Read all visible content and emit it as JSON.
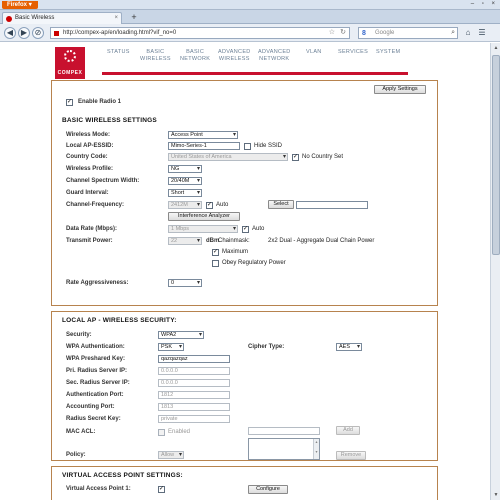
{
  "browser": {
    "app_button": "Firefox",
    "tab_title": "Basic Wireless",
    "url": "http://compex-ap/en/loading.html?vif_no=0",
    "search_placeholder": "Google",
    "window_controls": "– ▫ ×"
  },
  "icons": [
    "firefox-menu-icon",
    "favicon-icon",
    "back-icon",
    "forward-icon",
    "stop-icon",
    "home-icon",
    "star-icon",
    "reload-icon",
    "google-icon",
    "search-icon",
    "bookmarks-icon"
  ],
  "logo": {
    "text": "COMPEX",
    "color": "#c8102e"
  },
  "nav": [
    {
      "line1": "STATUS",
      "line2": ""
    },
    {
      "line1": "BASIC",
      "line2": "WIRELESS"
    },
    {
      "line1": "BASIC",
      "line2": "NETWORK"
    },
    {
      "line1": "ADVANCED",
      "line2": "WIRELESS"
    },
    {
      "line1": "ADVANCED",
      "line2": "NETWORK"
    },
    {
      "line1": "VLAN",
      "line2": ""
    },
    {
      "line1": "SERVICES",
      "line2": ""
    },
    {
      "line1": "SYSTEM",
      "line2": ""
    }
  ],
  "panel1": {
    "apply_button": "Apply Settings",
    "enable_radio": {
      "label": "Enable Radio 1",
      "checked": "✓"
    },
    "section_title": "BASIC WIRELESS SETTINGS",
    "labels": {
      "wireless_mode": "Wireless Mode:",
      "essid": "Local AP-ESSID:",
      "country": "Country Code:",
      "profile": "Wireless Profile:",
      "bandwidth": "Channel Spectrum Width:",
      "guard": "Guard Interval:",
      "frequency": "Channel-Frequency:",
      "data_rate": "Data Rate (Mbps):",
      "tx_power": "Transmit Power:",
      "aggressiveness": "Rate Aggressiveness:"
    },
    "values": {
      "wireless_mode": "Access Point",
      "essid": "Mimo-Series-1",
      "hide_ssid": "Hide SSID",
      "country": "United States of America",
      "no_country": "No Country Set",
      "profile": "NG",
      "bandwidth": "20/40M",
      "guard": "Short",
      "frequency": "2412M",
      "auto": "Auto",
      "select_button": "Select",
      "interference_button": "Interference Analyzer",
      "data_rate": "1 Mbps",
      "data_rate_auto": "Auto",
      "tx_power": "22",
      "dbm": "dBm",
      "chainmask_label": "Chainmask:",
      "chainmask_value": "2x2 Dual - Aggregate Dual Chain Power",
      "maximum": "Maximum",
      "obey": "Obey Regulatory Power",
      "aggressiveness": "0"
    }
  },
  "panel2": {
    "section_title": "LOCAL AP - WIRELESS SECURITY:",
    "labels": {
      "security": "Security:",
      "wpa_auth": "WPA Authentication:",
      "cipher": "Cipher Type:",
      "psk": "WPA Preshared Key:",
      "pri_radius": "Pri. Radius Server IP:",
      "sec_radius": "Sec. Radius Server IP:",
      "auth_port": "Authentication Port:",
      "acct_port": "Accounting Port:",
      "radius_key": "Radius Secret Key:",
      "mac_acl": "MAC ACL:",
      "policy": "Policy:"
    },
    "values": {
      "security": "WPA2",
      "wpa_auth": "PSK",
      "cipher": "AES",
      "psk": "qazqazqaz",
      "pri_radius": "0.0.0.0",
      "sec_radius": "0.0.0.0",
      "auth_port": "1812",
      "acct_port": "1813",
      "radius_key": "private",
      "mac_enabled": "Enabled",
      "add_button": "Add",
      "policy": "Allow",
      "remove_button": "Remove"
    }
  },
  "panel3": {
    "section_title": "VIRTUAL ACCESS POINT SETTINGS:",
    "vap_label": "Virtual Access Point 1:",
    "vap_checked": "✓",
    "configure_button": "Configure"
  }
}
